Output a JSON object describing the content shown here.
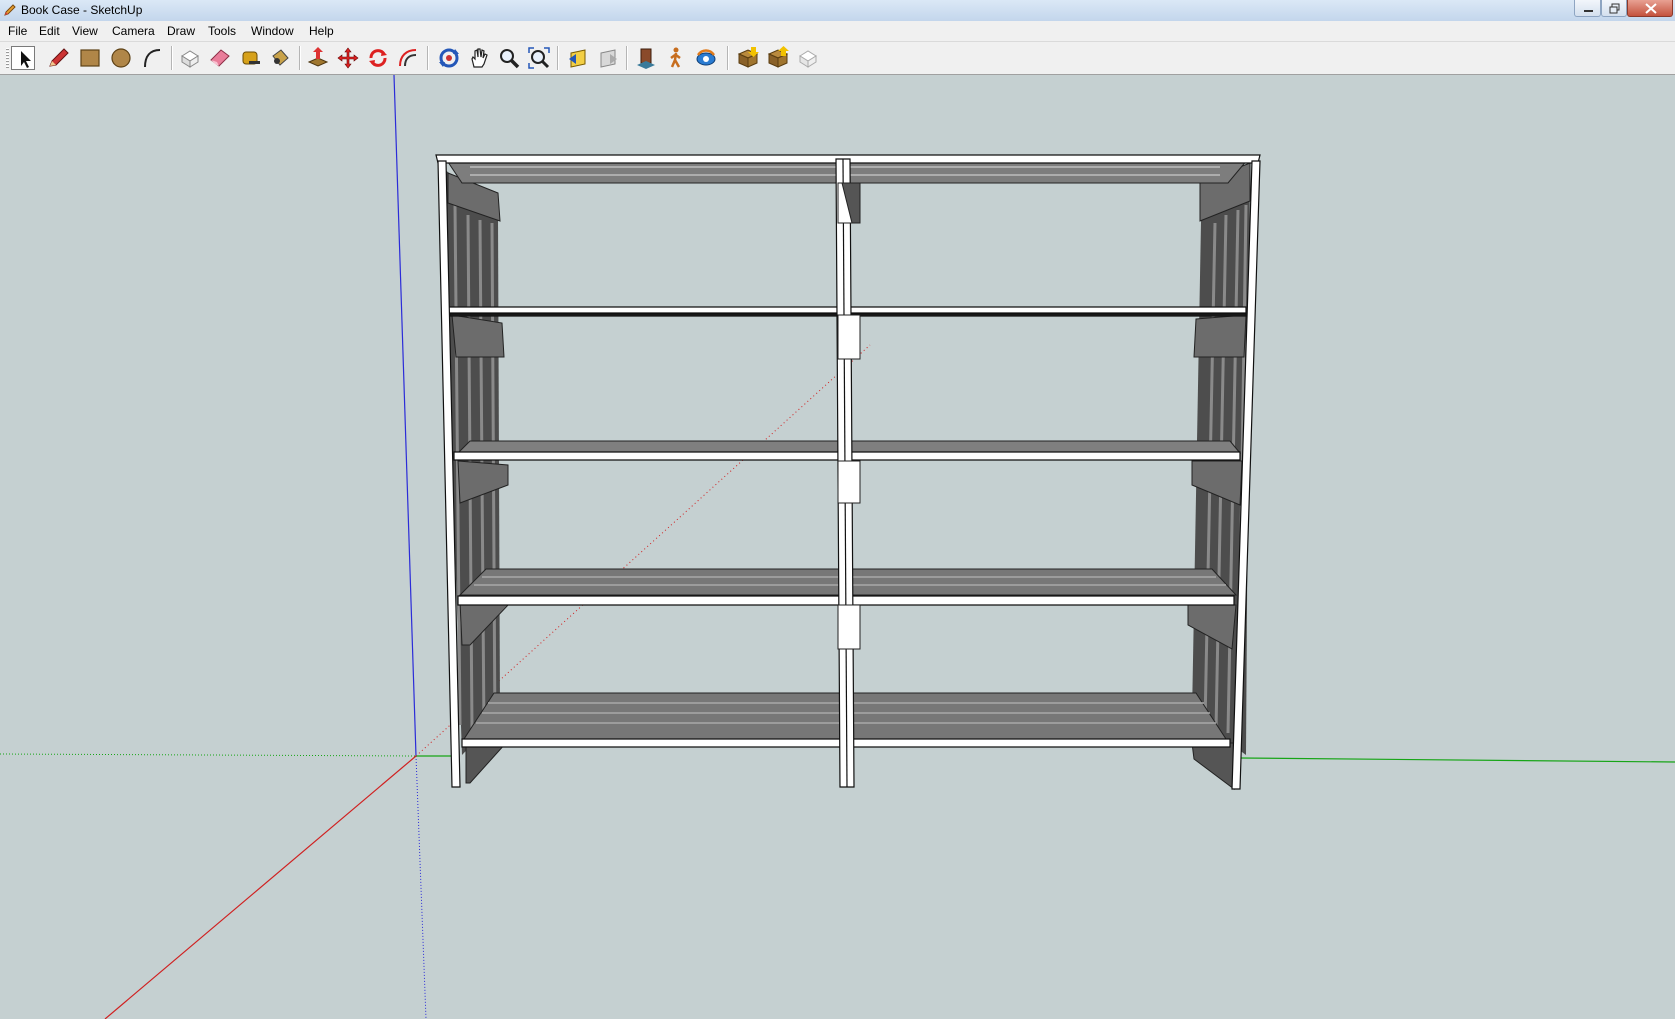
{
  "window": {
    "title": "Book Case - SketchUp",
    "icon": "sketchup-pencil-icon"
  },
  "menu": [
    "File",
    "Edit",
    "View",
    "Camera",
    "Draw",
    "Tools",
    "Window",
    "Help"
  ],
  "toolbar": {
    "tools": [
      {
        "name": "select-tool",
        "icon": "arrow-cursor-icon",
        "active": true
      },
      {
        "name": "line-tool",
        "icon": "pencil-icon"
      },
      {
        "name": "rectangle-tool",
        "icon": "rectangle-icon"
      },
      {
        "name": "circle-tool",
        "icon": "circle-icon"
      },
      {
        "name": "arc-tool",
        "icon": "arc-icon"
      },
      {
        "name": "make-component-tool",
        "icon": "component-icon"
      },
      {
        "name": "eraser-tool",
        "icon": "eraser-icon"
      },
      {
        "name": "tape-measure-tool",
        "icon": "tape-measure-icon"
      },
      {
        "name": "paint-bucket-tool",
        "icon": "paint-bucket-icon"
      },
      {
        "name": "push-pull-tool",
        "icon": "push-pull-icon"
      },
      {
        "name": "move-tool",
        "icon": "move-icon"
      },
      {
        "name": "rotate-tool",
        "icon": "rotate-icon"
      },
      {
        "name": "offset-tool",
        "icon": "offset-icon"
      },
      {
        "name": "orbit-tool",
        "icon": "orbit-icon"
      },
      {
        "name": "pan-tool",
        "icon": "hand-icon"
      },
      {
        "name": "zoom-tool",
        "icon": "magnifier-icon"
      },
      {
        "name": "zoom-extents-tool",
        "icon": "zoom-extents-icon"
      },
      {
        "name": "previous-view-tool",
        "icon": "previous-view-icon"
      },
      {
        "name": "next-view-tool",
        "icon": "next-view-icon"
      },
      {
        "name": "position-camera-tool",
        "icon": "position-camera-icon"
      },
      {
        "name": "walk-tool",
        "icon": "walk-icon"
      },
      {
        "name": "look-around-tool",
        "icon": "look-around-icon"
      },
      {
        "name": "get-models-tool",
        "icon": "get-models-icon"
      },
      {
        "name": "share-model-tool",
        "icon": "share-model-icon"
      },
      {
        "name": "share-component-tool",
        "icon": "share-component-icon"
      }
    ]
  },
  "colors": {
    "background": "#c5d0d1",
    "axis_red": "#d02020",
    "axis_green": "#17a517",
    "axis_blue": "#2b2bd8",
    "shelf_face": "#ffffff",
    "shelf_top": "#7a7a7a",
    "shadow": "#4a4a4a"
  }
}
